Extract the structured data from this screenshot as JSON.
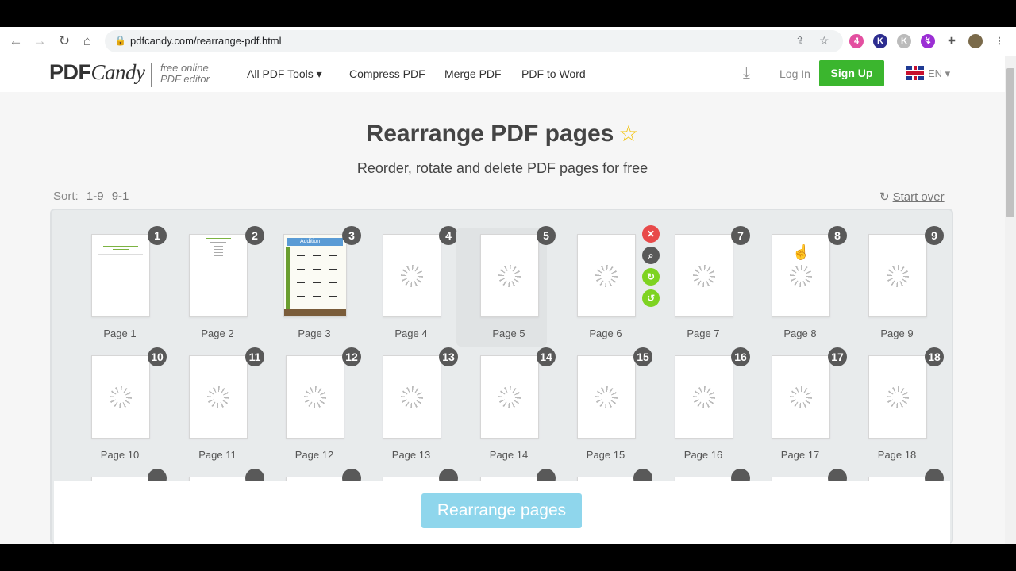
{
  "browser": {
    "url": "pdfcandy.com/rearrange-pdf.html",
    "ext_badge": "4"
  },
  "header": {
    "logo_bold": "PDF",
    "logo_script": "Candy",
    "tagline_1": "free online",
    "tagline_2": "PDF editor",
    "nav": [
      "All PDF Tools",
      "Compress PDF",
      "Merge PDF",
      "PDF to Word"
    ],
    "login": "Log In",
    "signup": "Sign Up",
    "lang": "EN"
  },
  "main": {
    "title": "Rearrange PDF pages",
    "subtitle": "Reorder, rotate and delete PDF pages for free",
    "sort_label": "Sort:",
    "sort_asc": "1-9",
    "sort_desc": "9-1",
    "start_over": "Start over",
    "pages": [
      {
        "num": "1",
        "label": "Page 1"
      },
      {
        "num": "2",
        "label": "Page 2"
      },
      {
        "num": "3",
        "label": "Page 3"
      },
      {
        "num": "4",
        "label": "Page 4"
      },
      {
        "num": "5",
        "label": "Page 5"
      },
      {
        "num": "6",
        "label": "Page 6"
      },
      {
        "num": "7",
        "label": "Page 7"
      },
      {
        "num": "8",
        "label": "Page 8"
      },
      {
        "num": "9",
        "label": "Page 9"
      },
      {
        "num": "10",
        "label": "Page 10"
      },
      {
        "num": "11",
        "label": "Page 11"
      },
      {
        "num": "12",
        "label": "Page 12"
      },
      {
        "num": "13",
        "label": "Page 13"
      },
      {
        "num": "14",
        "label": "Page 14"
      },
      {
        "num": "15",
        "label": "Page 15"
      },
      {
        "num": "16",
        "label": "Page 16"
      },
      {
        "num": "17",
        "label": "Page 17"
      },
      {
        "num": "18",
        "label": "Page 18"
      }
    ],
    "page3_thumb_text": "Addition",
    "action_button": "Rearrange pages"
  },
  "colors": {
    "signup_green": "#3bb62e",
    "badge_gray": "#595959",
    "delete_red": "#e84a4a",
    "rotate_green": "#7ed321",
    "cta_blue": "#8fd6ec"
  }
}
